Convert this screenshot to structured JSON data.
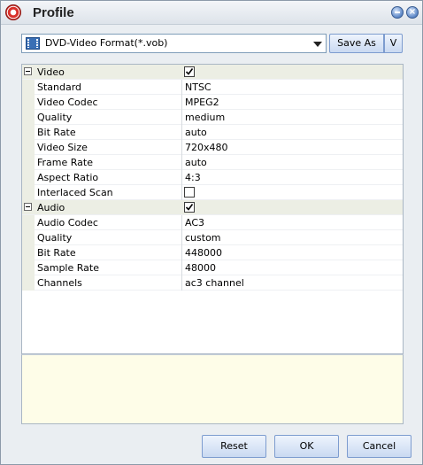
{
  "window": {
    "title": "Profile",
    "minimize_icon": "minimize-icon",
    "close_icon": "close-icon"
  },
  "format": {
    "selected": "DVD-Video Format(*.vob)",
    "icon": "film-icon"
  },
  "toolbar": {
    "save_as_label": "Save As",
    "menu_label": "V"
  },
  "grid": {
    "video": {
      "label": "Video",
      "enabled": true,
      "rows": [
        {
          "name": "Standard",
          "value": "NTSC"
        },
        {
          "name": "Video Codec",
          "value": "MPEG2"
        },
        {
          "name": "Quality",
          "value": "medium"
        },
        {
          "name": "Bit Rate",
          "value": "auto"
        },
        {
          "name": "Video Size",
          "value": "720x480"
        },
        {
          "name": "Frame Rate",
          "value": "auto"
        },
        {
          "name": "Aspect Ratio",
          "value": "4:3"
        },
        {
          "name": "Interlaced Scan",
          "value": ""
        }
      ],
      "interlaced_checked": false
    },
    "audio": {
      "label": "Audio",
      "enabled": true,
      "rows": [
        {
          "name": "Audio Codec",
          "value": "AC3"
        },
        {
          "name": "Quality",
          "value": "custom"
        },
        {
          "name": "Bit Rate",
          "value": "448000"
        },
        {
          "name": "Sample Rate",
          "value": "48000"
        },
        {
          "name": "Channels",
          "value": "ac3 channel"
        }
      ]
    }
  },
  "buttons": {
    "reset": "Reset",
    "ok": "OK",
    "cancel": "Cancel"
  }
}
